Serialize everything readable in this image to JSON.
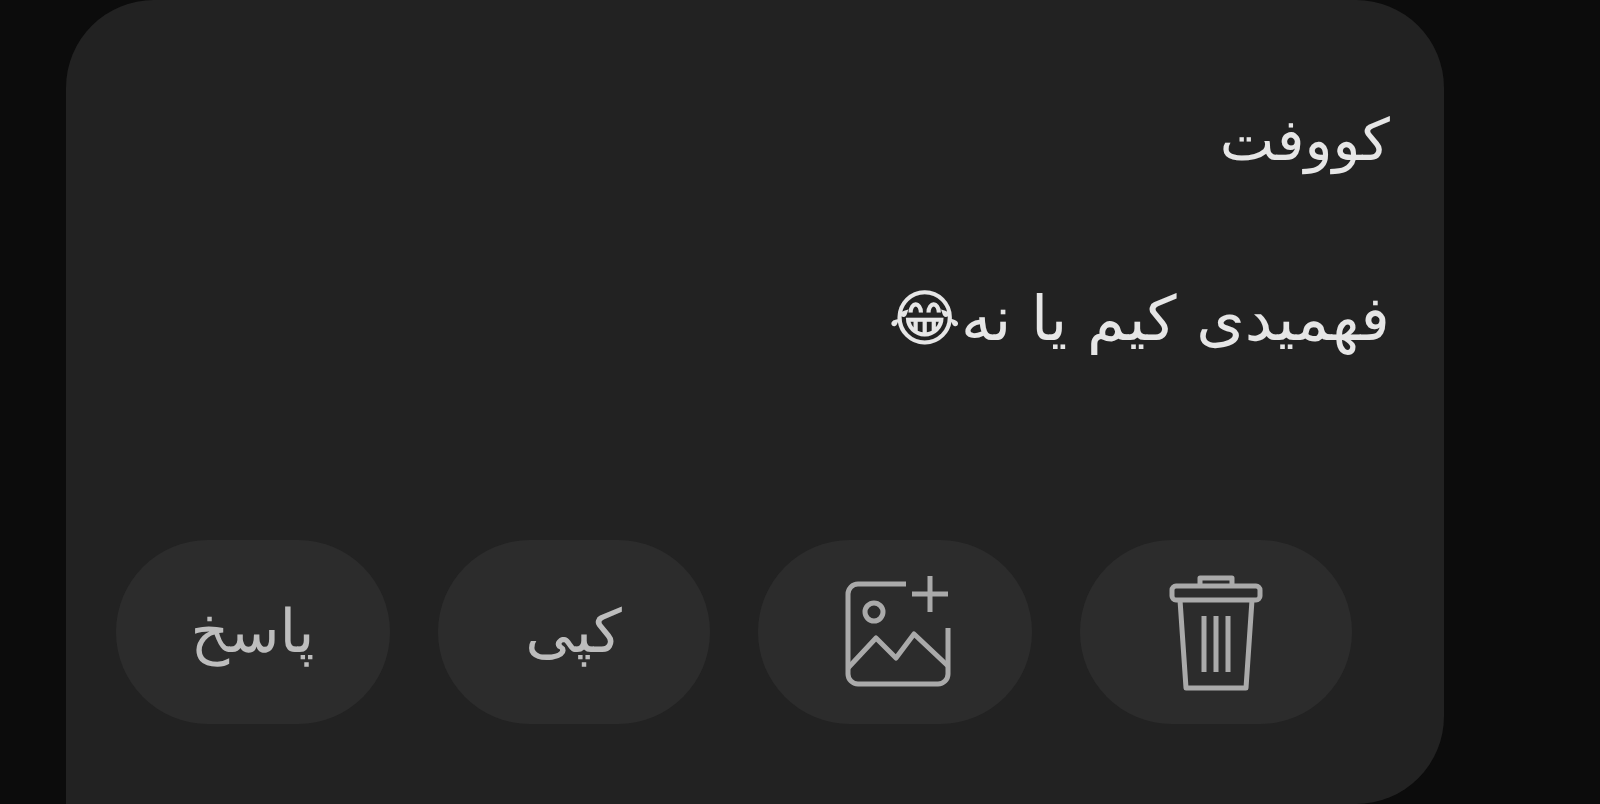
{
  "message": {
    "sender": "کووفت",
    "text": "فهمیدی کیم یا نه😂"
  },
  "actions": [
    {
      "kind": "delete"
    },
    {
      "kind": "add-image"
    },
    {
      "kind": "text",
      "label": "کپی"
    },
    {
      "kind": "text",
      "label": "پاسخ"
    }
  ]
}
